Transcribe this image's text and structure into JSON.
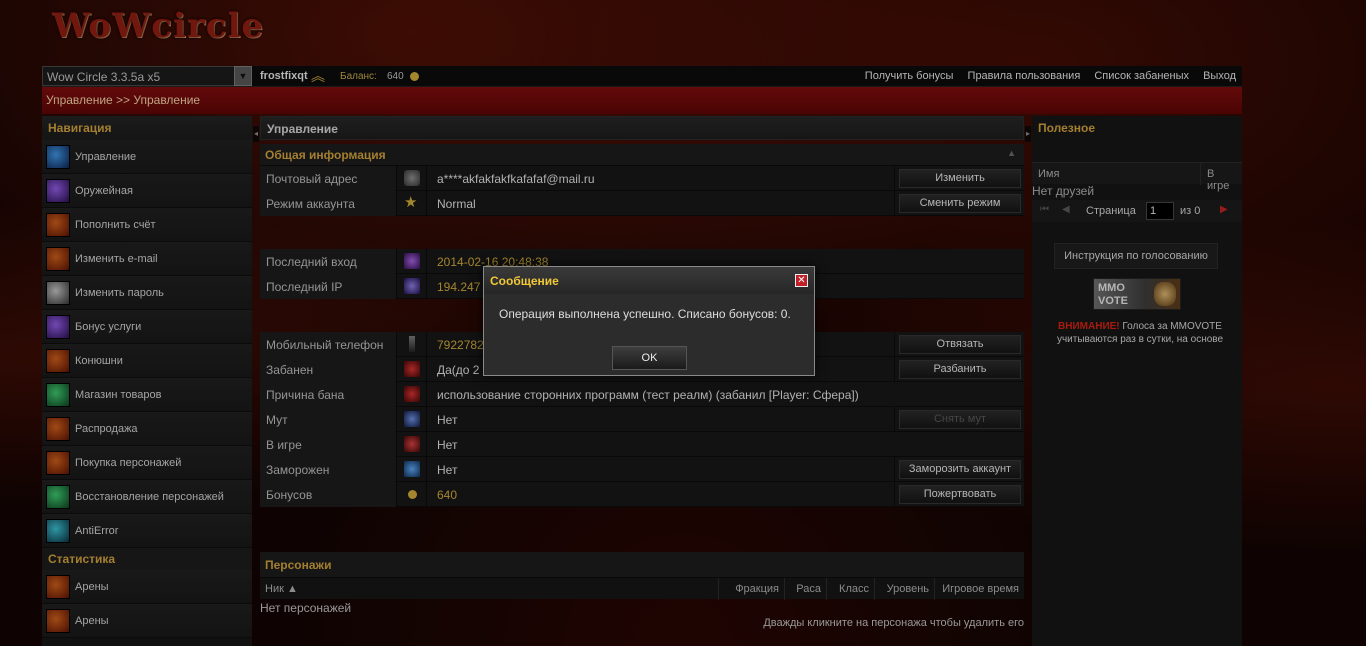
{
  "header": {
    "logo": "WoWcircle",
    "server_select": "Wow Circle 3.3.5a x5",
    "username": "frostfixqt",
    "balance_label": "Баланс:",
    "balance_value": "640",
    "links": [
      "Получить бонусы",
      "Правила пользования",
      "Список забаненых",
      "Выход"
    ]
  },
  "breadcrumb": "Управление >> Управление",
  "sidebar": {
    "heading": "Навигация",
    "items": [
      {
        "label": "Управление",
        "icon": "manage-icon"
      },
      {
        "label": "Оружейная",
        "icon": "armory-icon"
      },
      {
        "label": "Пополнить счёт",
        "icon": "deposit-icon"
      },
      {
        "label": "Изменить e-mail",
        "icon": "email-icon"
      },
      {
        "label": "Изменить пароль",
        "icon": "password-icon"
      },
      {
        "label": "Бонус услуги",
        "icon": "bonus-icon"
      },
      {
        "label": "Конюшни",
        "icon": "stable-icon"
      },
      {
        "label": "Магазин товаров",
        "icon": "shop-icon"
      },
      {
        "label": "Распродажа",
        "icon": "sale-icon"
      },
      {
        "label": "Покупка персонажей",
        "icon": "buy-character-icon"
      },
      {
        "label": "Восстановление персонажей",
        "icon": "restore-character-icon"
      },
      {
        "label": "AntiError",
        "icon": "antierror-icon"
      }
    ],
    "stats_heading": "Статистика",
    "stats_items": [
      {
        "label": "Арены",
        "icon": "arena-icon"
      },
      {
        "label": "Арены",
        "icon": "arena-icon"
      }
    ]
  },
  "main": {
    "title": "Управление",
    "general_heading": "Общая информация",
    "rows": {
      "email": {
        "label": "Почтовый адрес",
        "value": "a****akfakfakfkafafaf@mail.ru",
        "button": "Изменить"
      },
      "mode": {
        "label": "Режим аккаунта",
        "value": "Normal",
        "button": "Сменить режим"
      },
      "last_login": {
        "label": "Последний вход",
        "value": "2014-02-16 20:48:38"
      },
      "last_ip": {
        "label": "Последний IP",
        "value": "194.247"
      },
      "phone": {
        "label": "Мобильный телефон",
        "value": "7922782",
        "button": "Отвязать"
      },
      "banned": {
        "label": "Забанен",
        "value": "Да(до 2",
        "button": "Разбанить"
      },
      "ban_reason": {
        "label": "Причина бана",
        "value": "использование сторонних программ (тест реалм) (забанил [Player: Сфера])"
      },
      "mute": {
        "label": "Мут",
        "value": "Нет",
        "button": "Снять мут"
      },
      "ingame": {
        "label": "В игре",
        "value": "Нет"
      },
      "frozen": {
        "label": "Заморожен",
        "value": "Нет",
        "button": "Заморозить аккаунт"
      },
      "bonuses": {
        "label": "Бонусов",
        "value": "640",
        "button": "Пожертвовать"
      }
    },
    "characters": {
      "heading": "Персонажи",
      "columns": [
        "Ник ▲",
        "Фракция",
        "Раса",
        "Класс",
        "Уровень",
        "Игровое время"
      ],
      "empty": "Нет персонажей",
      "hint": "Дважды кликните на персонажа чтобы удалить его"
    }
  },
  "right": {
    "heading": "Полезное",
    "friends_columns": [
      "Имя",
      "В игре"
    ],
    "no_friends": "Нет друзей",
    "page_label": "Страница",
    "page_value": "1",
    "page_of": "из 0",
    "vote_button": "Инструкция по голосованию",
    "vote_banner": "MMO VOTE",
    "vote_warning": "ВНИМАНИЕ!",
    "vote_text": " Голоса за MMOVOTE учитываются раз в сутки, на основе"
  },
  "dialog": {
    "title": "Сообщение",
    "message": "Операция выполнена успешно. Списано бонусов: 0.",
    "ok": "OK",
    "close": "✕"
  }
}
